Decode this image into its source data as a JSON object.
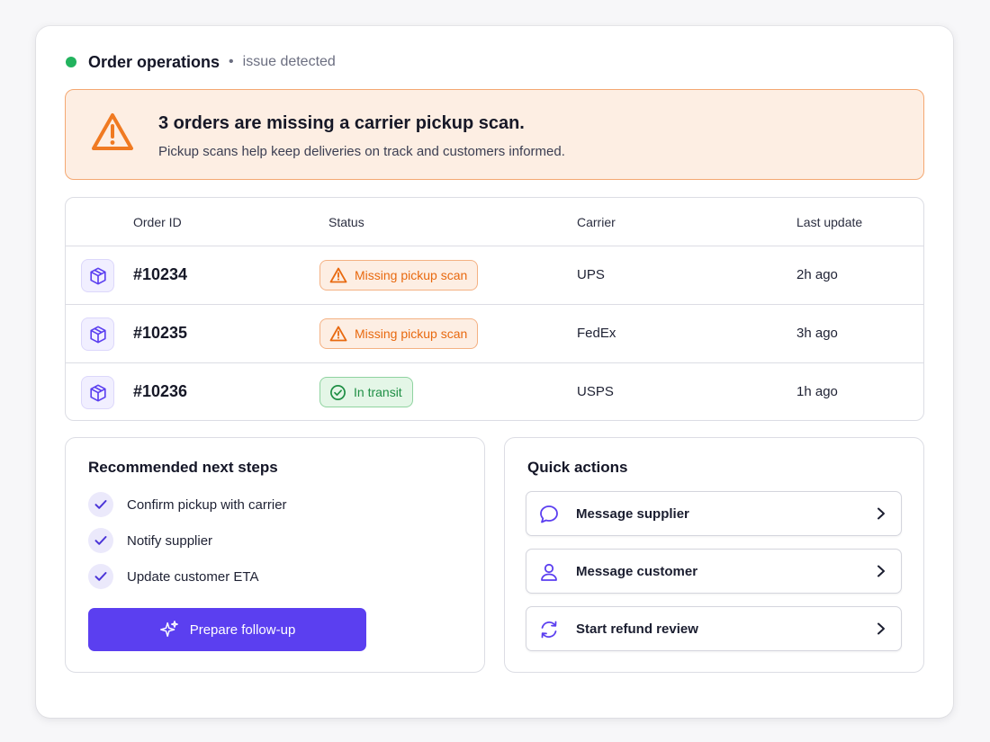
{
  "header": {
    "title": "Order operations",
    "separator": "•",
    "status": "issue detected",
    "status_color": "#22b35e"
  },
  "alert": {
    "icon": "warning-triangle-icon",
    "title": "3 orders are missing a carrier pickup scan.",
    "description": "Pickup scans help keep deliveries on track and customers informed.",
    "accent": "#f07a22"
  },
  "table": {
    "columns": [
      "Order ID",
      "Status",
      "Carrier",
      "Last update"
    ],
    "rows": [
      {
        "icon": "package-icon",
        "order_id": "#10234",
        "status": "Missing pickup scan",
        "status_type": "warning",
        "carrier": "UPS",
        "last_update": "2h ago"
      },
      {
        "icon": "package-icon",
        "order_id": "#10235",
        "status": "Missing pickup scan",
        "status_type": "warning",
        "carrier": "FedEx",
        "last_update": "3h ago"
      },
      {
        "icon": "package-icon",
        "order_id": "#10236",
        "status": "In transit",
        "status_type": "success",
        "carrier": "USPS",
        "last_update": "1h ago"
      }
    ]
  },
  "next_steps": {
    "title": "Recommended next steps",
    "items": [
      "Confirm pickup with carrier",
      "Notify supplier",
      "Update customer ETA"
    ],
    "button_label": "Prepare follow-up",
    "button_icon": "sparkles-icon"
  },
  "quick_actions": {
    "title": "Quick actions",
    "items": [
      {
        "label": "Message supplier",
        "icon": "chat-bubble-icon"
      },
      {
        "label": "Message customer",
        "icon": "user-icon"
      },
      {
        "label": "Start refund review",
        "icon": "refresh-icon"
      }
    ]
  },
  "colors": {
    "accent": "#5b3ff0",
    "warning": "#e8690f",
    "success": "#1f8f45"
  }
}
